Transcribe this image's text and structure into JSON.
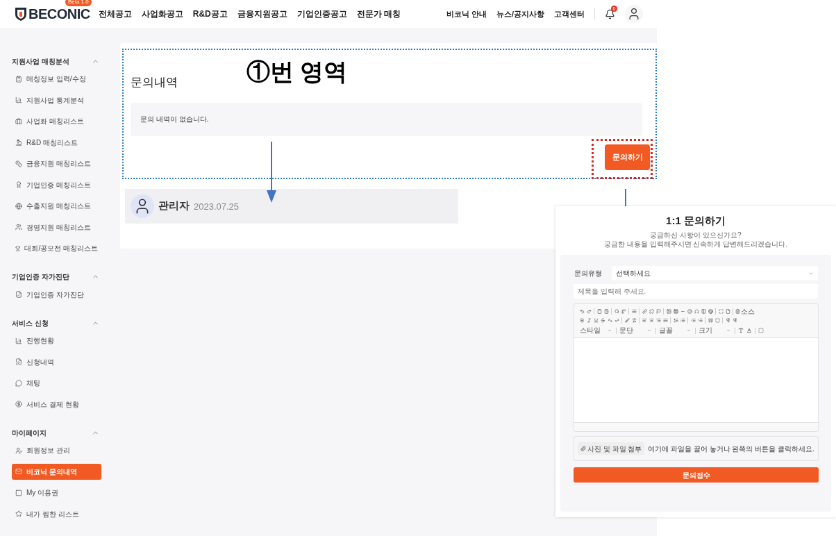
{
  "header": {
    "logo": "BECONIC",
    "logo_badge": "Beta 1.0",
    "nav": [
      "전체공고",
      "사업화공고",
      "R&D공고",
      "금융지원공고",
      "기업인증공고",
      "전문가 매칭"
    ],
    "links": [
      "비코닉 안내",
      "뉴스/공지사항",
      "고객센터"
    ],
    "notification_count": "0"
  },
  "sidebar": {
    "sections": [
      {
        "title": "지원사업 매칭분석",
        "expanded": true,
        "items": [
          {
            "label": "매칭정보 입력/수정",
            "selected": false
          },
          {
            "label": "지원사업 통계분석",
            "selected": false
          },
          {
            "label": "사업화 매칭리스트",
            "selected": false
          },
          {
            "label": "R&D 매칭리스트",
            "selected": false
          },
          {
            "label": "금융지원 매칭리스트",
            "selected": false
          },
          {
            "label": "기업인증 매칭리스트",
            "selected": false
          },
          {
            "label": "수출지원 매칭리스트",
            "selected": false
          },
          {
            "label": "경영지원 매칭리스트",
            "selected": false
          },
          {
            "label": "대회/공모전 매칭리스트",
            "selected": false
          }
        ]
      },
      {
        "title": "기업인증 자가진단",
        "expanded": true,
        "items": [
          {
            "label": "기업인증 자가진단",
            "selected": false
          }
        ]
      },
      {
        "title": "서비스 신청",
        "expanded": true,
        "items": [
          {
            "label": "진행현황",
            "selected": false
          },
          {
            "label": "신청내역",
            "selected": false
          },
          {
            "label": "채팅",
            "selected": false
          },
          {
            "label": "서비스 결제 현황",
            "selected": false
          }
        ]
      },
      {
        "title": "마이페이지",
        "expanded": true,
        "items": [
          {
            "label": "회원정보 관리",
            "selected": false
          },
          {
            "label": "비코닉 문의내역",
            "selected": true
          },
          {
            "label": "My 이용권",
            "selected": false
          },
          {
            "label": "내가 찜한 리스트",
            "selected": false
          }
        ]
      }
    ]
  },
  "inquiries": {
    "title": "문의내역",
    "empty_message": "문의 내역이 없습니다.",
    "button": "문의하기",
    "reply": {
      "author": "관리자",
      "date": "2023.07.25"
    }
  },
  "annotation": {
    "label": "①번 영역"
  },
  "dialog": {
    "title": "1:1 문의하기",
    "subtitle": [
      "궁금하신 사항이 있으신가요?",
      "궁금한 내용을 입력해주시면 신속하게 답변해드리겠습니다."
    ],
    "type_label": "문의유형",
    "type_value": "선택하세요",
    "title_placeholder": "제목을 입력해 주세요.",
    "source_label": "소스",
    "dropdowns": [
      "스타일",
      "문단",
      "글꼴",
      "크기"
    ],
    "attach_button": "사진 및 파일 첨부",
    "attach_hint": "여기에 파일을 끌어 놓거나 왼쪽의 버튼을 클릭하세요.",
    "submit": "문의접수"
  }
}
